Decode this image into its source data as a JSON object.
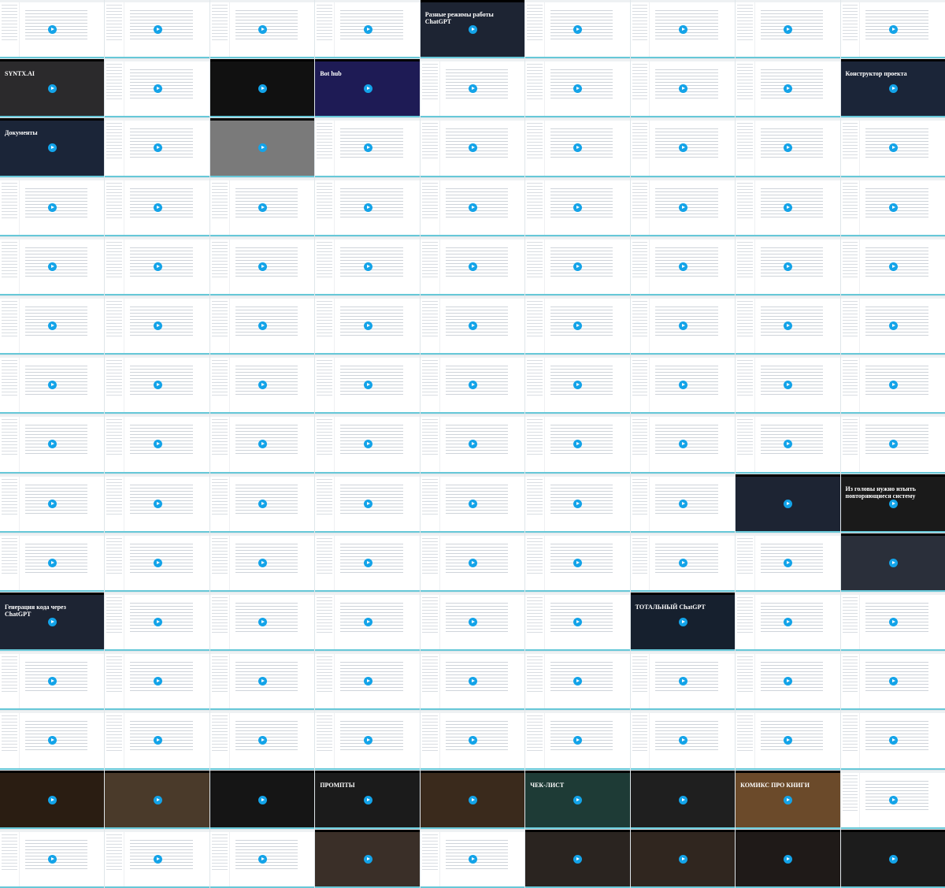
{
  "rows": 15,
  "cols": 9,
  "accent": "#13a3e8",
  "strip_color": "#67c8d8",
  "tiles": [
    {
      "row": 1,
      "col": 5,
      "bg": "#1d2433",
      "text": "Разные режимы работы ChatGPT"
    },
    {
      "row": 2,
      "col": 1,
      "bg": "#2b2a2c",
      "text": "SYNTX.AI"
    },
    {
      "row": 2,
      "col": 3,
      "bg": "#111111",
      "text": ""
    },
    {
      "row": 2,
      "col": 4,
      "bg": "#1e1b55",
      "text": "Bot hub"
    },
    {
      "row": 2,
      "col": 9,
      "bg": "#1b2538",
      "text": "Конструктор проекта"
    },
    {
      "row": 3,
      "col": 1,
      "bg": "#1b2538",
      "text": "Документы"
    },
    {
      "row": 3,
      "col": 3,
      "bg": "#7a7a7a",
      "text": ""
    },
    {
      "row": 9,
      "col": 8,
      "bg": "#1d2433",
      "text": ""
    },
    {
      "row": 9,
      "col": 9,
      "bg": "#1a1a1a",
      "text": "Из головы нужно изъять повторяющиеся систему"
    },
    {
      "row": 10,
      "col": 9,
      "bg": "#2a2f3a",
      "text": ""
    },
    {
      "row": 11,
      "col": 1,
      "bg": "#1d2433",
      "text": "Генерация кода через ChatGPT"
    },
    {
      "row": 11,
      "col": 7,
      "bg": "#16202e",
      "text": "ТОТАЛЬНЫЙ ChatGPT"
    },
    {
      "row": 14,
      "col": 1,
      "bg": "#2a1d12",
      "text": ""
    },
    {
      "row": 14,
      "col": 2,
      "bg": "#4a3a2a",
      "text": ""
    },
    {
      "row": 14,
      "col": 3,
      "bg": "#151515",
      "text": ""
    },
    {
      "row": 14,
      "col": 4,
      "bg": "#1b1b1b",
      "text": "ПРОМПТЫ"
    },
    {
      "row": 14,
      "col": 5,
      "bg": "#3a2a1c",
      "text": ""
    },
    {
      "row": 14,
      "col": 6,
      "bg": "#1e3b36",
      "text": "ЧЕК-ЛИСТ"
    },
    {
      "row": 14,
      "col": 7,
      "bg": "#1f1f1f",
      "text": ""
    },
    {
      "row": 14,
      "col": 8,
      "bg": "#6b4a2a",
      "text": "КОМИКС ПРО КНИГИ"
    },
    {
      "row": 15,
      "col": 4,
      "bg": "#3a2f28",
      "text": ""
    },
    {
      "row": 15,
      "col": 6,
      "bg": "#2a2420",
      "text": ""
    },
    {
      "row": 15,
      "col": 7,
      "bg": "#30261f",
      "text": ""
    },
    {
      "row": 15,
      "col": 8,
      "bg": "#1f1a18",
      "text": ""
    },
    {
      "row": 15,
      "col": 9,
      "bg": "#1c1c1c",
      "text": ""
    }
  ]
}
